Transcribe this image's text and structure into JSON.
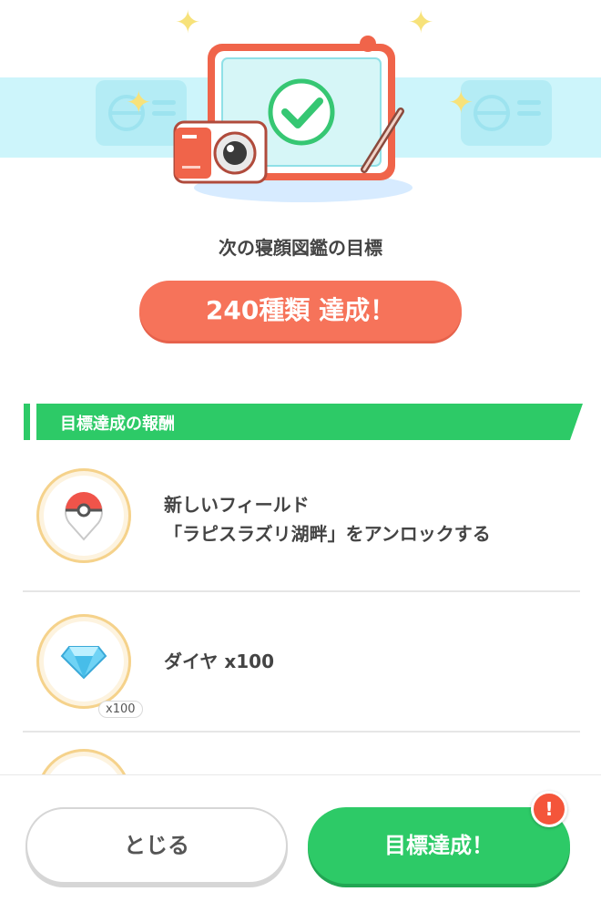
{
  "header": {
    "goal_label": "次の寝顔図鑑の目標",
    "goal_value": "240種類 達成！"
  },
  "rewards": {
    "section_title": "目標達成の報酬",
    "items": [
      {
        "icon": "field-pin-icon",
        "text_line1": "新しいフィールド",
        "text_line2": "「ラピスラズリ湖畔」をアンロックする"
      },
      {
        "icon": "diamond-icon",
        "text_line1": "ダイヤ x100",
        "badge": "x100"
      }
    ]
  },
  "footer": {
    "close_label": "とじる",
    "goal_button_label": "目標達成！",
    "alert_symbol": "!"
  },
  "colors": {
    "accent_green": "#2dca67",
    "accent_coral": "#f6735a",
    "alert_red": "#f4553a"
  }
}
